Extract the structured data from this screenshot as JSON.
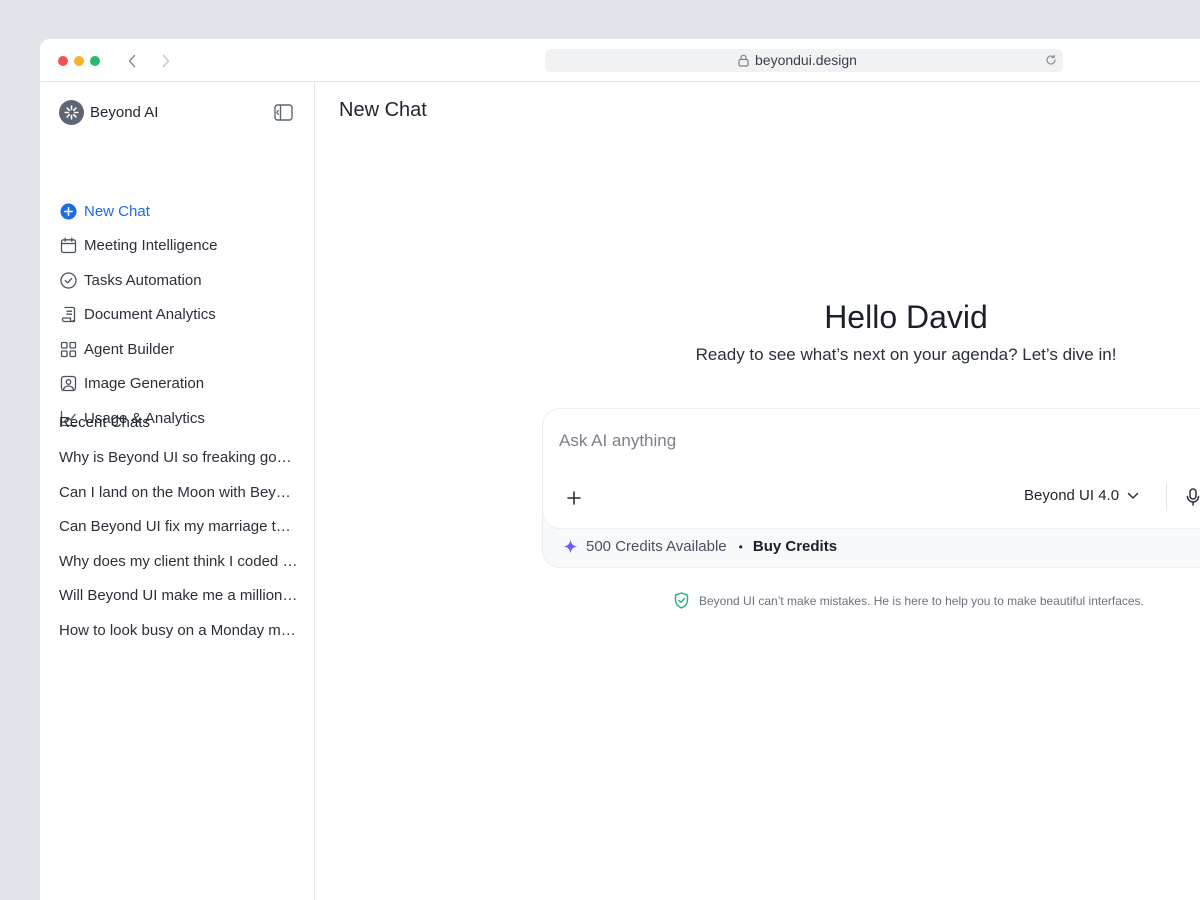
{
  "browser": {
    "url": "beyondui.design"
  },
  "sidebar": {
    "brand_name": "Beyond AI",
    "menu": [
      {
        "label": "New Chat",
        "icon": "plus-circle-icon"
      },
      {
        "label": "Meeting Intelligence",
        "icon": "calendar-icon"
      },
      {
        "label": "Tasks Automation",
        "icon": "check-circle-icon"
      },
      {
        "label": "Document Analytics",
        "icon": "document-icon"
      },
      {
        "label": "Agent Builder",
        "icon": "grid-icon"
      },
      {
        "label": "Image Generation",
        "icon": "image-icon"
      },
      {
        "label": "Usage & Analytics",
        "icon": "line-chart-icon"
      }
    ],
    "recent_title": "Recent Chats",
    "recent_chats": [
      "Why is Beyond UI so freaking good?",
      "Can I land on the Moon with Beyond UI?",
      "Can Beyond UI fix my marriage too?",
      "Why does my client think I coded this?",
      "Will Beyond UI make me a millionaire?",
      "How to look busy on a Monday morning"
    ]
  },
  "main": {
    "title": "New Chat",
    "greeting": "Hello David",
    "subgreeting": "Ready to see what’s next on your agenda? Let’s dive in!",
    "composer": {
      "placeholder": "Ask AI anything",
      "value": "",
      "model": "Beyond UI 4.0",
      "credits": "500 Credits Available",
      "separator": "•",
      "buy_credits": "Buy Credits"
    },
    "disclaimer": "Beyond UI can’t make mistakes. He is here to help you to make beautiful interfaces."
  },
  "colors": {
    "accent": "#1a6ce8",
    "sparkle": "#6b5cf0",
    "shield": "#22b07d",
    "background": "#e2e5ea"
  }
}
